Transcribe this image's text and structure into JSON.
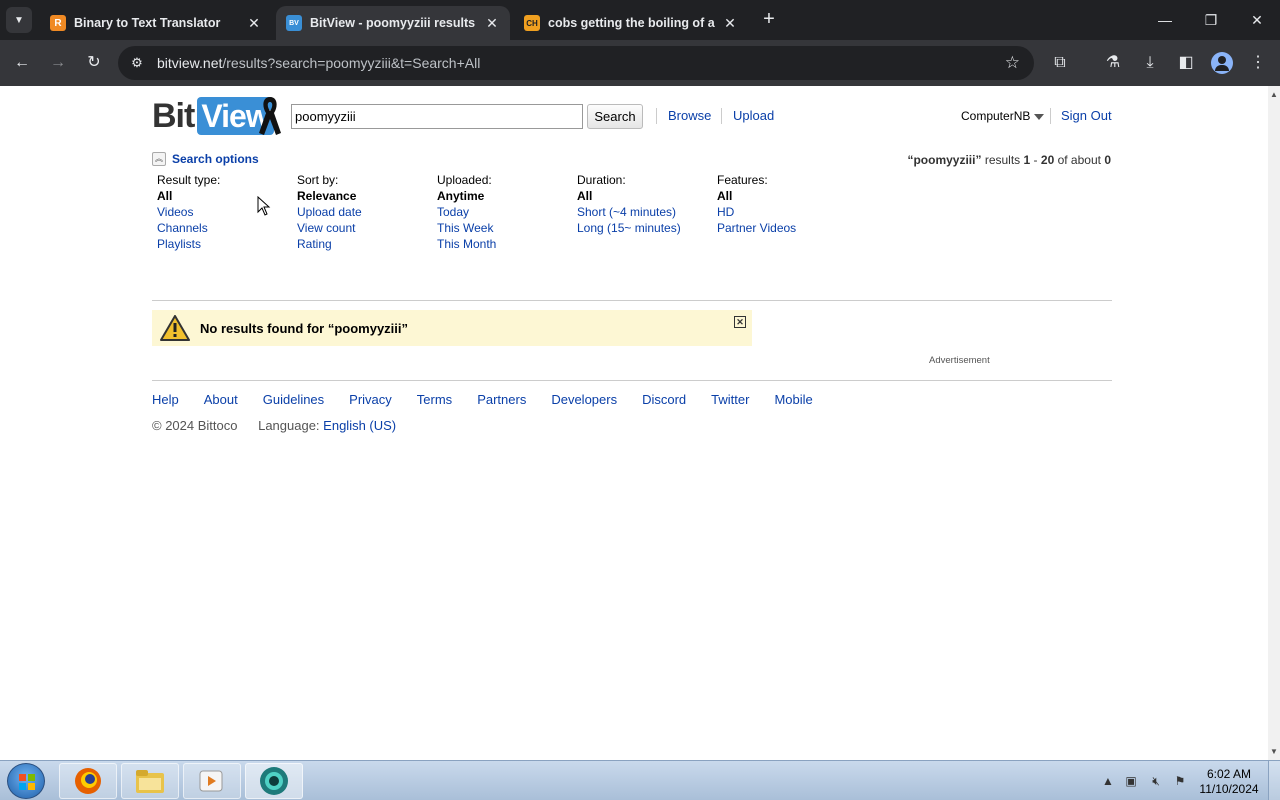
{
  "browser": {
    "tabs": [
      {
        "title": "Binary to Text Translator",
        "favicon": "R",
        "favicon_color": "#f08a24",
        "active": false
      },
      {
        "title": "BitView - poomyyziii results",
        "favicon": "BV",
        "favicon_color": "#3a8fd6",
        "active": true
      },
      {
        "title": "cobs getting the boiling of a li",
        "favicon": "CH",
        "favicon_color": "#f0a020",
        "active": false
      }
    ],
    "url_host": "bitview.net",
    "url_path": "/results?search=poomyyziii&t=Search+All"
  },
  "site": {
    "logo_left": "Bit",
    "logo_right": "View",
    "search_value": "poomyyziii",
    "search_button": "Search",
    "nav": {
      "browse": "Browse",
      "upload": "Upload"
    },
    "user": "ComputerNB",
    "sign_out": "Sign Out"
  },
  "search_options": {
    "label": "Search options",
    "summary": {
      "query": "“poomyyziii”",
      "results_word": "results",
      "from": "1",
      "dash": "-",
      "to": "20",
      "of_about": "of about",
      "total": "0"
    },
    "filters": [
      {
        "heading": "Result type:",
        "selected": "All",
        "options": [
          "Videos",
          "Channels",
          "Playlists"
        ]
      },
      {
        "heading": "Sort by:",
        "selected": "Relevance",
        "options": [
          "Upload date",
          "View count",
          "Rating"
        ]
      },
      {
        "heading": "Uploaded:",
        "selected": "Anytime",
        "options": [
          "Today",
          "This Week",
          "This Month"
        ]
      },
      {
        "heading": "Duration:",
        "selected": "All",
        "options": [
          "Short (~4 minutes)",
          "Long (15~ minutes)"
        ]
      },
      {
        "heading": "Features:",
        "selected": "All",
        "options": [
          "HD",
          "Partner Videos"
        ]
      }
    ]
  },
  "notice": {
    "message": "No results found for “poomyyziii”"
  },
  "ad_label": "Advertisement",
  "footer": {
    "links": [
      "Help",
      "About",
      "Guidelines",
      "Privacy",
      "Terms",
      "Partners",
      "Developers",
      "Discord",
      "Twitter",
      "Mobile"
    ],
    "copyright": "© 2024 Bittoco",
    "language_label": "Language:",
    "language": "English (US)"
  },
  "taskbar": {
    "time": "6:02 AM",
    "date": "11/10/2024",
    "apps": [
      "firefox-icon",
      "file-explorer-icon",
      "media-player-icon",
      "chrome-app-icon"
    ]
  },
  "colors": {
    "link": "#0a3fa8",
    "notice_bg": "#fdf7d4",
    "logo_blue": "#3a8fd6"
  }
}
